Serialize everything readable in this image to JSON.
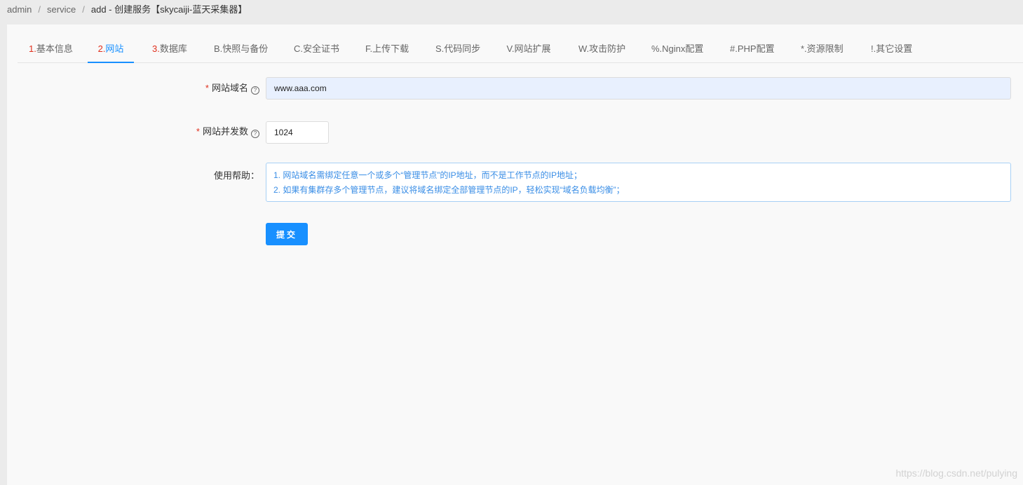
{
  "breadcrumb": {
    "items": [
      "admin",
      "service"
    ],
    "current": "add - 创建服务【skycaiji-蓝天采集器】"
  },
  "tabs": [
    {
      "num": "1.",
      "label": "基本信息"
    },
    {
      "num": "2.",
      "label": "网站"
    },
    {
      "num": "3.",
      "label": "数据库"
    },
    {
      "num": "",
      "label": "B.快照与备份"
    },
    {
      "num": "",
      "label": "C.安全证书"
    },
    {
      "num": "",
      "label": "F.上传下载"
    },
    {
      "num": "",
      "label": "S.代码同步"
    },
    {
      "num": "",
      "label": "V.网站扩展"
    },
    {
      "num": "",
      "label": "W.攻击防护"
    },
    {
      "num": "",
      "label": "%.Nginx配置"
    },
    {
      "num": "",
      "label": "#.PHP配置"
    },
    {
      "num": "",
      "label": "*.资源限制"
    },
    {
      "num": "",
      "label": "!.其它设置"
    }
  ],
  "active_tab": "网站",
  "form": {
    "domain": {
      "required_mark": "*",
      "label": "网站域名",
      "value": "www.aaa.com"
    },
    "concurrency": {
      "required_mark": "*",
      "label": "网站并发数",
      "value": "1024"
    },
    "help": {
      "label": "使用帮助：",
      "lines": [
        "1. 网站域名需绑定任意一个或多个“管理节点”的IP地址，而不是工作节点的IP地址；",
        "2. 如果有集群存多个管理节点，建议将域名绑定全部管理节点的IP，轻松实现“域名负载均衡”；"
      ]
    },
    "submit_label": "提交"
  },
  "watermark": "https://blog.csdn.net/pulying",
  "colors": {
    "accent": "#1890ff",
    "required": "#e0301e",
    "help_text": "#3a8ee6"
  }
}
